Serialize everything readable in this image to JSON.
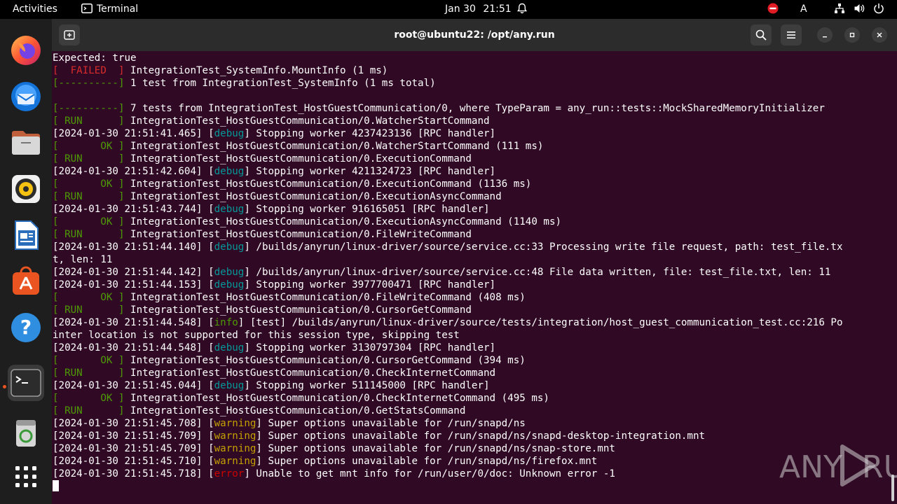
{
  "topbar": {
    "activities": "Activities",
    "app_name": "Terminal",
    "date": "Jan 30",
    "time": "21:51",
    "input_indicator": "A"
  },
  "dock": {
    "items": [
      {
        "name": "Firefox"
      },
      {
        "name": "Thunderbird"
      },
      {
        "name": "Files"
      },
      {
        "name": "Rhythmbox"
      },
      {
        "name": "LibreOffice Writer"
      },
      {
        "name": "Ubuntu Software"
      },
      {
        "name": "Help"
      },
      {
        "name": "Terminal"
      },
      {
        "name": "Trash"
      },
      {
        "name": "Show Applications"
      }
    ]
  },
  "window": {
    "title": "root@ubuntu22: /opt/any.run"
  },
  "terminal": {
    "lines": [
      [
        {
          "t": "Expected: true"
        }
      ],
      [
        {
          "t": "[  FAILED  ]",
          "c": "red"
        },
        {
          "t": " IntegrationTest_SystemInfo.MountInfo (1 ms)"
        }
      ],
      [
        {
          "t": "[----------]",
          "c": "green"
        },
        {
          "t": " 1 test from IntegrationTest_SystemInfo (1 ms total)"
        }
      ],
      [
        {
          "t": ""
        }
      ],
      [
        {
          "t": "[----------]",
          "c": "green"
        },
        {
          "t": " 7 tests from IntegrationTest_HostGuestCommunication/0, where TypeParam = any_run::tests::MockSharedMemoryInitializer"
        }
      ],
      [
        {
          "t": "[ RUN      ]",
          "c": "green"
        },
        {
          "t": " IntegrationTest_HostGuestCommunication/0.WatcherStartCommand"
        }
      ],
      [
        {
          "t": "[2024-01-30 21:51:41.465] ["
        },
        {
          "t": "debug",
          "c": "cyan"
        },
        {
          "t": "] Stopping worker 4237423136 [RPC handler]"
        }
      ],
      [
        {
          "t": "[       OK ]",
          "c": "green"
        },
        {
          "t": " IntegrationTest_HostGuestCommunication/0.WatcherStartCommand (111 ms)"
        }
      ],
      [
        {
          "t": "[ RUN      ]",
          "c": "green"
        },
        {
          "t": " IntegrationTest_HostGuestCommunication/0.ExecutionCommand"
        }
      ],
      [
        {
          "t": "[2024-01-30 21:51:42.604] ["
        },
        {
          "t": "debug",
          "c": "cyan"
        },
        {
          "t": "] Stopping worker 4211324723 [RPC handler]"
        }
      ],
      [
        {
          "t": "[       OK ]",
          "c": "green"
        },
        {
          "t": " IntegrationTest_HostGuestCommunication/0.ExecutionCommand (1136 ms)"
        }
      ],
      [
        {
          "t": "[ RUN      ]",
          "c": "green"
        },
        {
          "t": " IntegrationTest_HostGuestCommunication/0.ExecutionAsyncCommand"
        }
      ],
      [
        {
          "t": "[2024-01-30 21:51:43.744] ["
        },
        {
          "t": "debug",
          "c": "cyan"
        },
        {
          "t": "] Stopping worker 916165051 [RPC handler]"
        }
      ],
      [
        {
          "t": "[       OK ]",
          "c": "green"
        },
        {
          "t": " IntegrationTest_HostGuestCommunication/0.ExecutionAsyncCommand (1140 ms)"
        }
      ],
      [
        {
          "t": "[ RUN      ]",
          "c": "green"
        },
        {
          "t": " IntegrationTest_HostGuestCommunication/0.FileWriteCommand"
        }
      ],
      [
        {
          "t": "[2024-01-30 21:51:44.140] ["
        },
        {
          "t": "debug",
          "c": "cyan"
        },
        {
          "t": "] /builds/anyrun/linux-driver/source/service.cc:33 Processing write file request, path: test_file.tx"
        }
      ],
      [
        {
          "t": "t, len: 11"
        }
      ],
      [
        {
          "t": "[2024-01-30 21:51:44.142] ["
        },
        {
          "t": "debug",
          "c": "cyan"
        },
        {
          "t": "] /builds/anyrun/linux-driver/source/service.cc:48 File data written, file: test_file.txt, len: 11"
        }
      ],
      [
        {
          "t": "[2024-01-30 21:51:44.153] ["
        },
        {
          "t": "debug",
          "c": "cyan"
        },
        {
          "t": "] Stopping worker 3977700471 [RPC handler]"
        }
      ],
      [
        {
          "t": "[       OK ]",
          "c": "green"
        },
        {
          "t": " IntegrationTest_HostGuestCommunication/0.FileWriteCommand (408 ms)"
        }
      ],
      [
        {
          "t": "[ RUN      ]",
          "c": "green"
        },
        {
          "t": " IntegrationTest_HostGuestCommunication/0.CursorGetCommand"
        }
      ],
      [
        {
          "t": "[2024-01-30 21:51:44.548] ["
        },
        {
          "t": "info",
          "c": "green"
        },
        {
          "t": "] [test] /builds/anyrun/linux-driver/source/tests/integration/host_guest_communication_test.cc:216 Po"
        }
      ],
      [
        {
          "t": "inter location is not supported for this session type, skipping test"
        }
      ],
      [
        {
          "t": "[2024-01-30 21:51:44.548] ["
        },
        {
          "t": "debug",
          "c": "cyan"
        },
        {
          "t": "] Stopping worker 3130797304 [RPC handler]"
        }
      ],
      [
        {
          "t": "[       OK ]",
          "c": "green"
        },
        {
          "t": " IntegrationTest_HostGuestCommunication/0.CursorGetCommand (394 ms)"
        }
      ],
      [
        {
          "t": "[ RUN      ]",
          "c": "green"
        },
        {
          "t": " IntegrationTest_HostGuestCommunication/0.CheckInternetCommand"
        }
      ],
      [
        {
          "t": "[2024-01-30 21:51:45.044] ["
        },
        {
          "t": "debug",
          "c": "cyan"
        },
        {
          "t": "] Stopping worker 511145000 [RPC handler]"
        }
      ],
      [
        {
          "t": "[       OK ]",
          "c": "green"
        },
        {
          "t": " IntegrationTest_HostGuestCommunication/0.CheckInternetCommand (495 ms)"
        }
      ],
      [
        {
          "t": "[ RUN      ]",
          "c": "green"
        },
        {
          "t": " IntegrationTest_HostGuestCommunication/0.GetStatsCommand"
        }
      ],
      [
        {
          "t": "[2024-01-30 21:51:45.708] ["
        },
        {
          "t": "warning",
          "c": "warn"
        },
        {
          "t": "] Super options unavailable for /run/snapd/ns"
        }
      ],
      [
        {
          "t": "[2024-01-30 21:51:45.709] ["
        },
        {
          "t": "warning",
          "c": "warn"
        },
        {
          "t": "] Super options unavailable for /run/snapd/ns/snapd-desktop-integration.mnt"
        }
      ],
      [
        {
          "t": "[2024-01-30 21:51:45.709] ["
        },
        {
          "t": "warning",
          "c": "warn"
        },
        {
          "t": "] Super options unavailable for /run/snapd/ns/snap-store.mnt"
        }
      ],
      [
        {
          "t": "[2024-01-30 21:51:45.710] ["
        },
        {
          "t": "warning",
          "c": "warn"
        },
        {
          "t": "] Super options unavailable for /run/snapd/ns/firefox.mnt"
        }
      ],
      [
        {
          "t": "[2024-01-30 21:51:45.718] ["
        },
        {
          "t": "error",
          "c": "err"
        },
        {
          "t": "] Unable to get mnt info for /run/user/0/doc: Unknown error -1"
        }
      ]
    ]
  },
  "watermark": {
    "text_left": "ANY",
    "text_right": "RUN"
  },
  "colors": {
    "terminal_bg": "#300a24",
    "failed_red": "#d92b2b",
    "ok_green": "#4e9a06",
    "debug_cyan": "#06989a",
    "warning_yellow": "#c4a000",
    "error_red": "#cc0000",
    "ubuntu_orange": "#e95420"
  }
}
